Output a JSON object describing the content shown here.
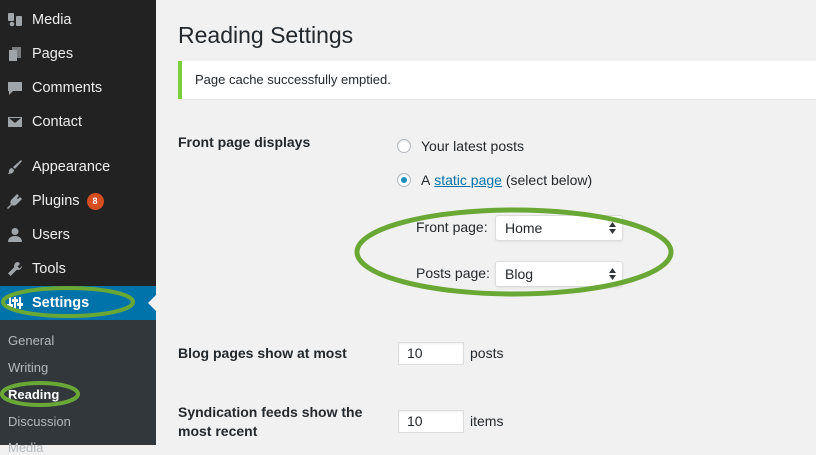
{
  "sidebar": {
    "items": [
      {
        "label": "Media",
        "icon": "media-icon"
      },
      {
        "label": "Pages",
        "icon": "pages-icon"
      },
      {
        "label": "Comments",
        "icon": "comments-icon"
      },
      {
        "label": "Contact",
        "icon": "envelope-icon"
      },
      {
        "label": "Appearance",
        "icon": "paintbrush-icon"
      },
      {
        "label": "Plugins",
        "icon": "plugin-icon",
        "badge": "8"
      },
      {
        "label": "Users",
        "icon": "users-icon"
      },
      {
        "label": "Tools",
        "icon": "wrench-icon"
      },
      {
        "label": "Settings",
        "icon": "settings-icon"
      }
    ],
    "submenu": [
      "General",
      "Writing",
      "Reading",
      "Discussion",
      "Media"
    ]
  },
  "page": {
    "title": "Reading Settings",
    "notice": "Page cache successfully emptied."
  },
  "front_page": {
    "label": "Front page displays",
    "option_latest": "Your latest posts",
    "option_static_prefix": "A",
    "option_static_link": "static page",
    "option_static_suffix": "(select below)",
    "front_page_label": "Front page:",
    "front_page_value": "Home",
    "posts_page_label": "Posts page:",
    "posts_page_value": "Blog"
  },
  "blog_pages": {
    "label": "Blog pages show at most",
    "value": "10",
    "unit": "posts"
  },
  "syndication": {
    "label_line1": "Syndication feeds show the",
    "label_line2": "most recent",
    "value": "10",
    "unit": "items"
  },
  "colors": {
    "sidebar_bg": "#222222",
    "submenu_bg": "#32373c",
    "accent": "#0073aa",
    "notice_border": "#7ad03a",
    "highlight_ring": "#6aa836",
    "badge": "#d54e21"
  }
}
